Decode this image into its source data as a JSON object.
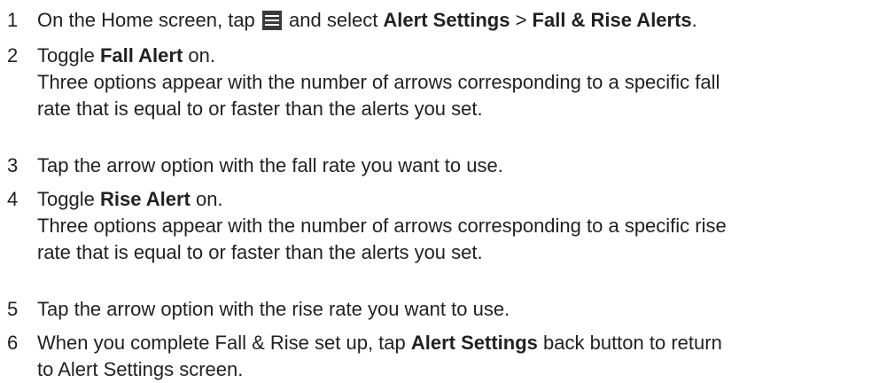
{
  "steps": [
    {
      "number": "1",
      "parts": {
        "a": "On the Home screen, tap ",
        "b": " and select ",
        "c": "Alert Settings",
        "d": " > ",
        "e": "Fall & Rise Alerts",
        "f": "."
      },
      "icon": "menu-icon"
    },
    {
      "number": "2",
      "parts": {
        "a": "Toggle ",
        "b": "Fall Alert",
        "c": " on."
      },
      "detail_lines": [
        "Three options appear with the number of arrows corresponding to a specific fall",
        "rate that is equal to or faster than the alerts you set."
      ]
    },
    {
      "number": "3",
      "text": "Tap the arrow option with the fall rate you want to use."
    },
    {
      "number": "4",
      "parts": {
        "a": "Toggle ",
        "b": "Rise Alert",
        "c": " on."
      },
      "detail_lines": [
        "Three options appear with the number of arrows corresponding to a specific rise",
        "rate that is equal to or faster than the alerts you set."
      ]
    },
    {
      "number": "5",
      "text": "Tap the arrow option with the rise rate you want to use."
    },
    {
      "number": "6",
      "parts": {
        "a": "When you complete Fall & Rise set up, tap ",
        "b": "Alert Settings",
        "c": " back button to return"
      },
      "line2": "to Alert Settings screen."
    }
  ]
}
